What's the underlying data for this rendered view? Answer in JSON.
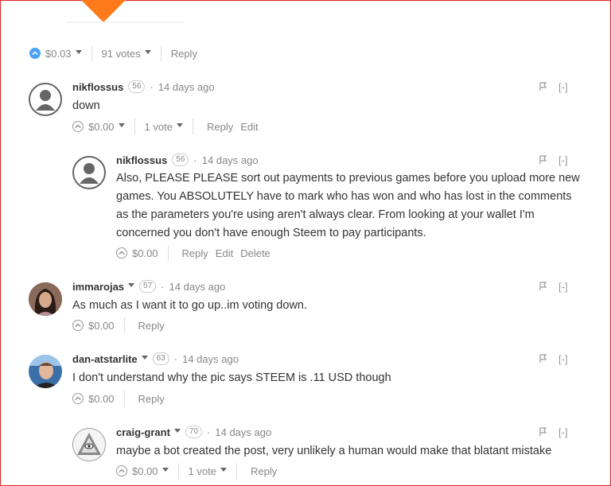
{
  "top": {
    "payout": "$0.03",
    "votes": "91 votes",
    "reply": "Reply"
  },
  "comments": [
    {
      "author": "nikflossus",
      "rep": "56",
      "time": "14 days ago",
      "text": "down",
      "payout": "$0.00",
      "votes": "1 vote",
      "actions": [
        "Reply",
        "Edit"
      ]
    },
    {
      "author": "nikflossus",
      "rep": "56",
      "time": "14 days ago",
      "text": "Also, PLEASE PLEASE sort out payments to previous games before you upload more new games. You ABSOLUTELY have to mark who has won and who has lost in the comments as the parameters you're using aren't always clear. From looking at your wallet I'm concerned you don't have enough Steem to pay participants.",
      "payout": "$0.00",
      "actions": [
        "Reply",
        "Edit",
        "Delete"
      ]
    },
    {
      "author": "immarojas",
      "rep": "57",
      "time": "14 days ago",
      "text": "As much as I want it to go up..im voting down.",
      "payout": "$0.00",
      "actions": [
        "Reply"
      ]
    },
    {
      "author": "dan-atstarlite",
      "rep": "63",
      "time": "14 days ago",
      "text": "I don't understand why the pic says STEEM is .11 USD though",
      "payout": "$0.00",
      "actions": [
        "Reply"
      ]
    },
    {
      "author": "craig-grant",
      "rep": "70",
      "time": "14 days ago",
      "text": "maybe a bot created the post, very unlikely a human would make that blatant mistake",
      "payout": "$0.00",
      "votes": "1 vote",
      "actions": [
        "Reply"
      ]
    }
  ],
  "flag_icon": "flag-icon",
  "collapse_label": "[-]",
  "colors": {
    "accent": "#4ba2f2",
    "brand_orange": "#ff7a1a",
    "frame": "#dd2222"
  }
}
